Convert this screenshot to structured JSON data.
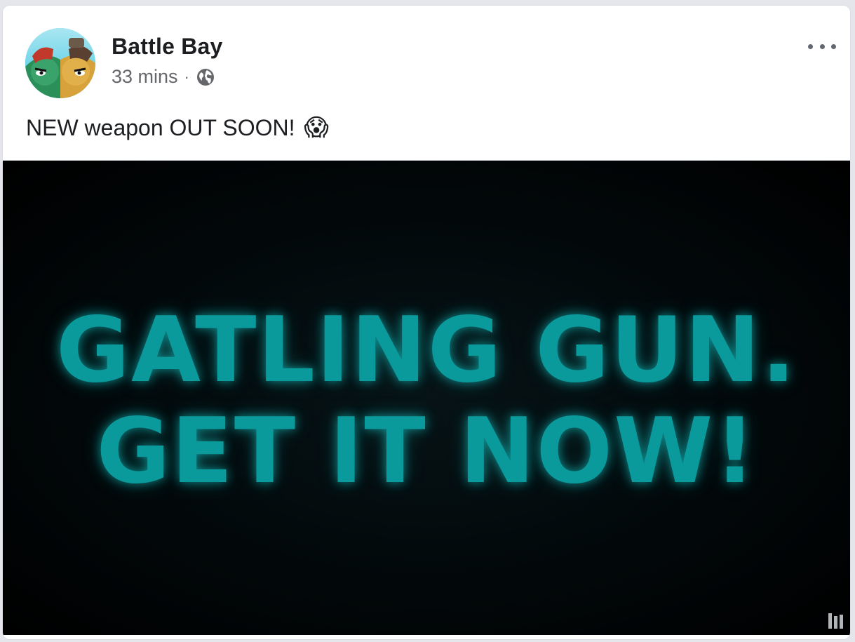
{
  "post": {
    "page_name": "Battle Bay",
    "time": "33 mins",
    "separator": "·",
    "privacy_icon": "globe-icon",
    "text": "NEW weapon OUT SOON!",
    "emoji": "😱",
    "more_icon": "more-options-icon"
  },
  "video": {
    "line1": "GATLING GUN.",
    "line2": "GET IT NOW!",
    "accent_color": "#0a9a9c",
    "corner_icon": "video-bars-icon"
  }
}
